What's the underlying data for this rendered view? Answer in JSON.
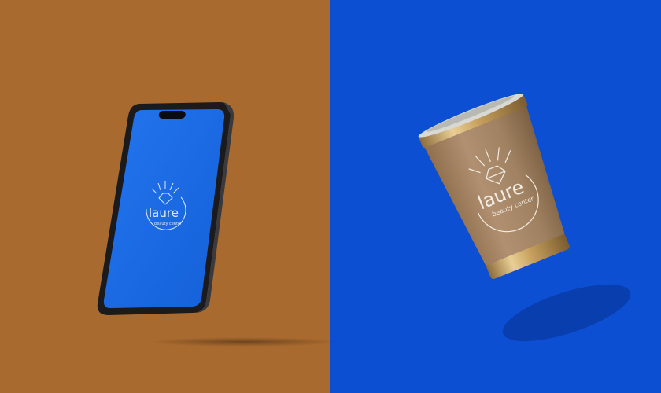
{
  "scene": {
    "left_background": "#a96a2f",
    "right_background": "#0d4fd3"
  },
  "phone": {
    "screen_color": "#1a6be6",
    "frame_color": "#1b1b1d",
    "logo": {
      "wordmark": "laure",
      "tagline": "beauty center",
      "ink": "#dfe8f5"
    }
  },
  "tumbler": {
    "body_color": "#a48360",
    "metal_color": "#d6b77c",
    "logo": {
      "wordmark": "laure",
      "tagline": "beauty center",
      "ink": "#f3ece2"
    }
  }
}
